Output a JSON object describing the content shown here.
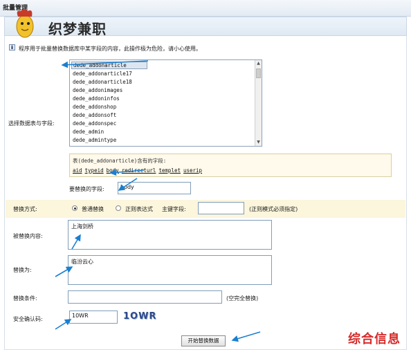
{
  "header": {
    "title": "批量管理"
  },
  "watermark_top": "织梦兼职",
  "watermark_bottom": "综合信息",
  "tip": "程序用于批量替换数据库中某字段的内容，此操作极为危险，请小心使用。",
  "table_label": "选择数据表与字段:",
  "tables": [
    "dede_addonarticle",
    "dede_addonarticle17",
    "dede_addonarticle18",
    "dede_addonimages",
    "dede_addoninfos",
    "dede_addonshop",
    "dede_addonsoft",
    "dede_addonspec",
    "dede_admin",
    "dede_admintype"
  ],
  "field_box": {
    "title": "表(dede_addonarticle)含有的字段:",
    "fields": [
      "aid",
      "typeid",
      "body",
      "redirecturl",
      "templet",
      "userip"
    ]
  },
  "replace_field": {
    "label": "要替换的字段:",
    "value": "body"
  },
  "mode": {
    "label": "替换方式:",
    "opt_normal": "普通替换",
    "opt_regex": "正则表达式",
    "key_label": "主键字段:",
    "key_value": "",
    "note": "(正则模式必须指定)"
  },
  "from": {
    "label": "被替换内容:",
    "value": "上海剑桥"
  },
  "to": {
    "label": "替换为:",
    "value": "临汾云心"
  },
  "condition": {
    "label": "替换条件:",
    "value": "",
    "note": "(空完全替换)"
  },
  "captcha": {
    "label": "安全确认码:",
    "value": "10WR",
    "image_text": "1OWR"
  },
  "submit_label": "开始替换数据",
  "colors": {
    "annotation_arrow": "#1a7fd0",
    "highlight_row": "#fbf6dc",
    "field_box_bg": "#fffaeb"
  }
}
